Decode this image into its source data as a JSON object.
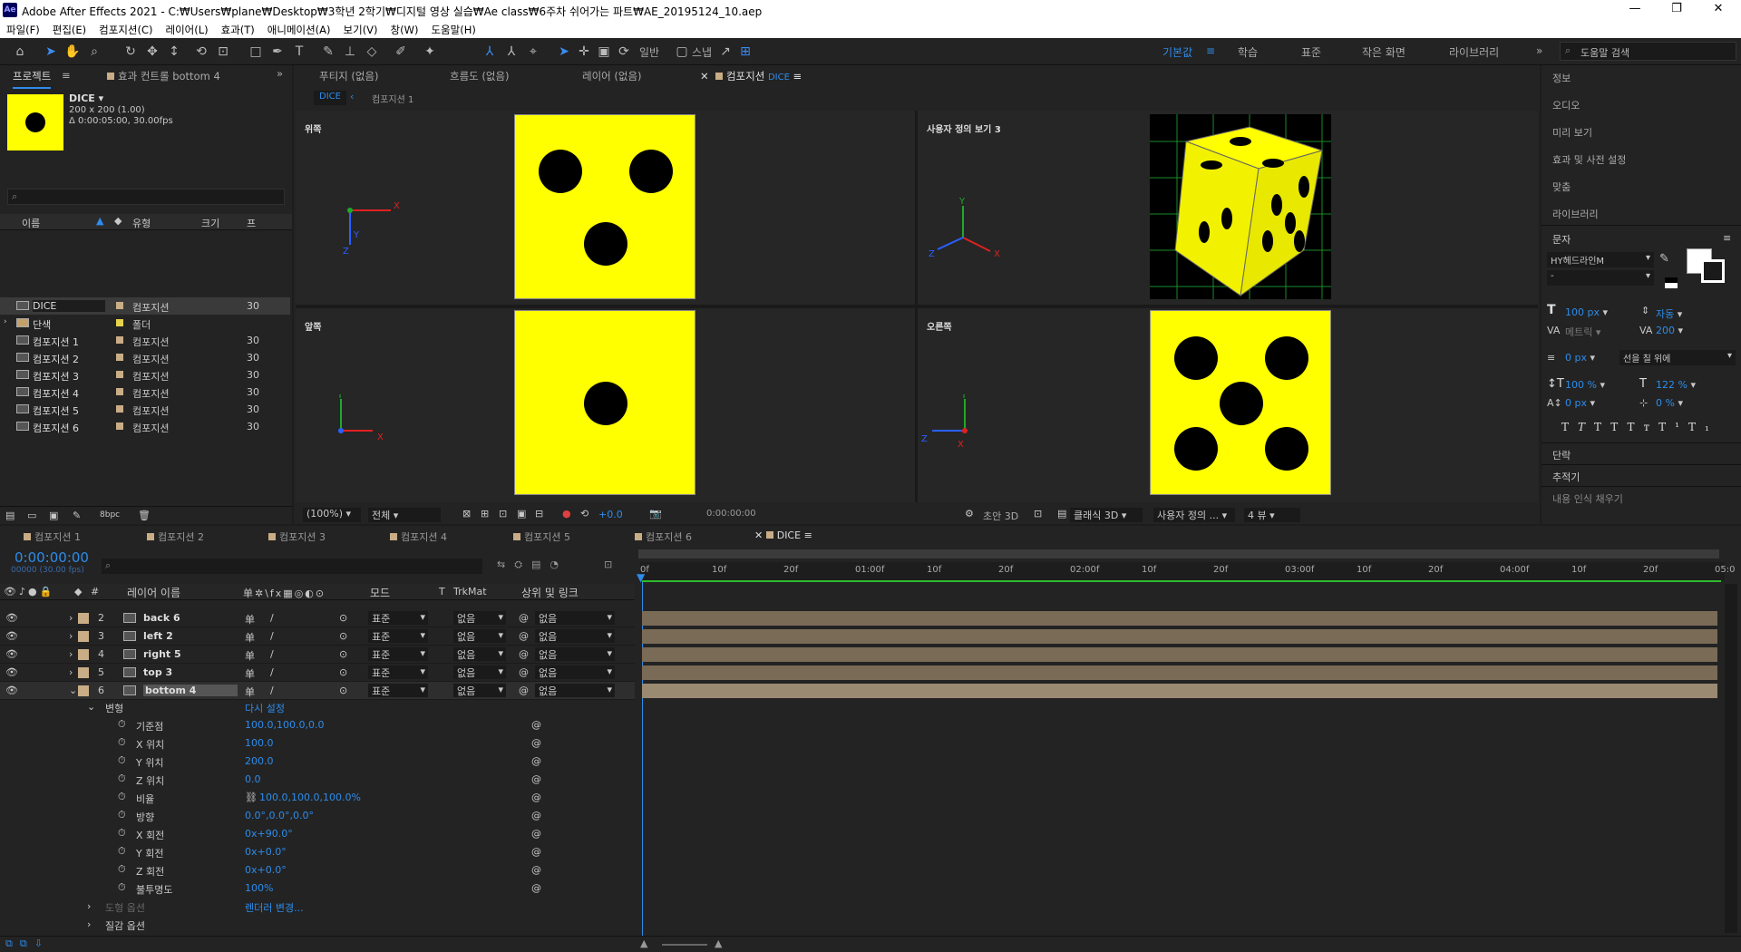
{
  "window": {
    "title": "Adobe After Effects 2021 - C:₩Users₩plane₩Desktop₩3학년 2학기₩디지털 영상 실습₩Ae class₩6주차 쉬어가는 파트₩AE_20195124_10.aep",
    "logo": "Ae"
  },
  "menu": [
    "파일(F)",
    "편집(E)",
    "컴포지션(C)",
    "레이어(L)",
    "효과(T)",
    "애니메이션(A)",
    "보기(V)",
    "창(W)",
    "도움말(H)"
  ],
  "toolbar": {
    "snap_label": "스냅",
    "align_label": "일반"
  },
  "workspaces": [
    "기본값",
    "학습",
    "표준",
    "작은 화면",
    "라이브러리"
  ],
  "search_help_placeholder": "도움말 검색",
  "project": {
    "tab": "프로젝트",
    "effects_tab": "효과 컨트롤 bottom 4",
    "item_name": "DICE ▾",
    "item_size": "200 x 200 (1.00)",
    "item_dur": "Δ 0:00:05:00, 30.00fps",
    "search_placeholder": "",
    "columns": [
      "이름",
      "유형",
      "크기",
      "프"
    ],
    "rows": [
      {
        "name": "DICE",
        "type": "컴포지션",
        "fps": "30",
        "selected": true
      },
      {
        "name": "단색",
        "type": "폴더",
        "fps": ""
      },
      {
        "name": "컴포지션 1",
        "type": "컴포지션",
        "fps": "30"
      },
      {
        "name": "컴포지션 2",
        "type": "컴포지션",
        "fps": "30"
      },
      {
        "name": "컴포지션 3",
        "type": "컴포지션",
        "fps": "30"
      },
      {
        "name": "컴포지션 4",
        "type": "컴포지션",
        "fps": "30"
      },
      {
        "name": "컴포지션 5",
        "type": "컴포지션",
        "fps": "30"
      },
      {
        "name": "컴포지션 6",
        "type": "컴포지션",
        "fps": "30"
      }
    ],
    "bpc": "8bpc"
  },
  "viewer": {
    "tabs": [
      "푸티지 (없음)",
      "흐름도 (없음)",
      "레이어 (없음)",
      "컴포지션"
    ],
    "active_comp": "DICE",
    "breadcrumb_active": "DICE",
    "breadcrumb_next": "컴포지션 1",
    "views": [
      "위쪽",
      "사용자 정의 보기 3",
      "앞쪽",
      "오른쪽"
    ],
    "zoom": "(100%)",
    "resolution": "전체",
    "exposure": "+0.0",
    "timecode": "0:00:00:00",
    "renderer": "초안 3D",
    "classic": "클래식 3D",
    "custom_view": "사용자 정의 ...",
    "view_count": "4 뷰"
  },
  "right_panel": {
    "items": [
      "정보",
      "오디오",
      "미리 보기",
      "효과 및 사전 설정",
      "맞춤",
      "라이브러리"
    ],
    "char_title": "문자",
    "font": "HY헤드라인M",
    "font_style": "-",
    "size": "100 px",
    "leading": "자동",
    "kerning": "메트릭",
    "tracking": "200",
    "stroke": "0 px",
    "stroke_mode": "선을 칠 위에",
    "vscale": "100 %",
    "hscale": "122 %",
    "baseline": "0 px",
    "tsume": "0 %",
    "para": "단락",
    "tracker": "추적기",
    "more": "내용 인식 채우기"
  },
  "timeline": {
    "tabs": [
      "컴포지션 1",
      "컴포지션 2",
      "컴포지션 3",
      "컴포지션 4",
      "컴포지션 5",
      "컴포지션 6",
      "DICE"
    ],
    "time": "0:00:00:00",
    "frames": "00000 (30.00 fps)",
    "col_layer": "레이어 이름",
    "col_mode": "모드",
    "col_t": "T",
    "col_trk": "TrkMat",
    "col_parent": "상위 및 링크",
    "ruler": [
      "0f",
      "10f",
      "20f",
      "01:00f",
      "10f",
      "20f",
      "02:00f",
      "10f",
      "20f",
      "03:00f",
      "10f",
      "20f",
      "04:00f",
      "10f",
      "20f",
      "05:0"
    ],
    "layers": [
      {
        "num": "2",
        "name": "back 6",
        "mode": "표준",
        "trk": "없음",
        "parent": "없음"
      },
      {
        "num": "3",
        "name": "left 2",
        "mode": "표준",
        "trk": "없음",
        "parent": "없음"
      },
      {
        "num": "4",
        "name": "right 5",
        "mode": "표준",
        "trk": "없음",
        "parent": "없음"
      },
      {
        "num": "5",
        "name": "top 3",
        "mode": "표준",
        "trk": "없음",
        "parent": "없음"
      },
      {
        "num": "6",
        "name": "bottom 4",
        "mode": "표준",
        "trk": "없음",
        "parent": "없음"
      }
    ],
    "transform_label": "변형",
    "reset_label": "다시 설정",
    "props": [
      {
        "name": "기준점",
        "value": "100.0,100.0,0.0"
      },
      {
        "name": "X 위치",
        "value": "100.0"
      },
      {
        "name": "Y 위치",
        "value": "200.0"
      },
      {
        "name": "Z 위치",
        "value": "0.0"
      },
      {
        "name": "비율",
        "value": "100.0,100.0,100.0%"
      },
      {
        "name": "방향",
        "value": "0.0°,0.0°,0.0°"
      },
      {
        "name": "X 회전",
        "value": "0x+90.0°"
      },
      {
        "name": "Y 회전",
        "value": "0x+0.0°"
      },
      {
        "name": "Z 회전",
        "value": "0x+0.0°"
      },
      {
        "name": "불투명도",
        "value": "100%"
      }
    ],
    "geometry_label": "도형 옵션",
    "geometry_value": "렌더러 변경...",
    "material_label": "질감 옵션"
  }
}
